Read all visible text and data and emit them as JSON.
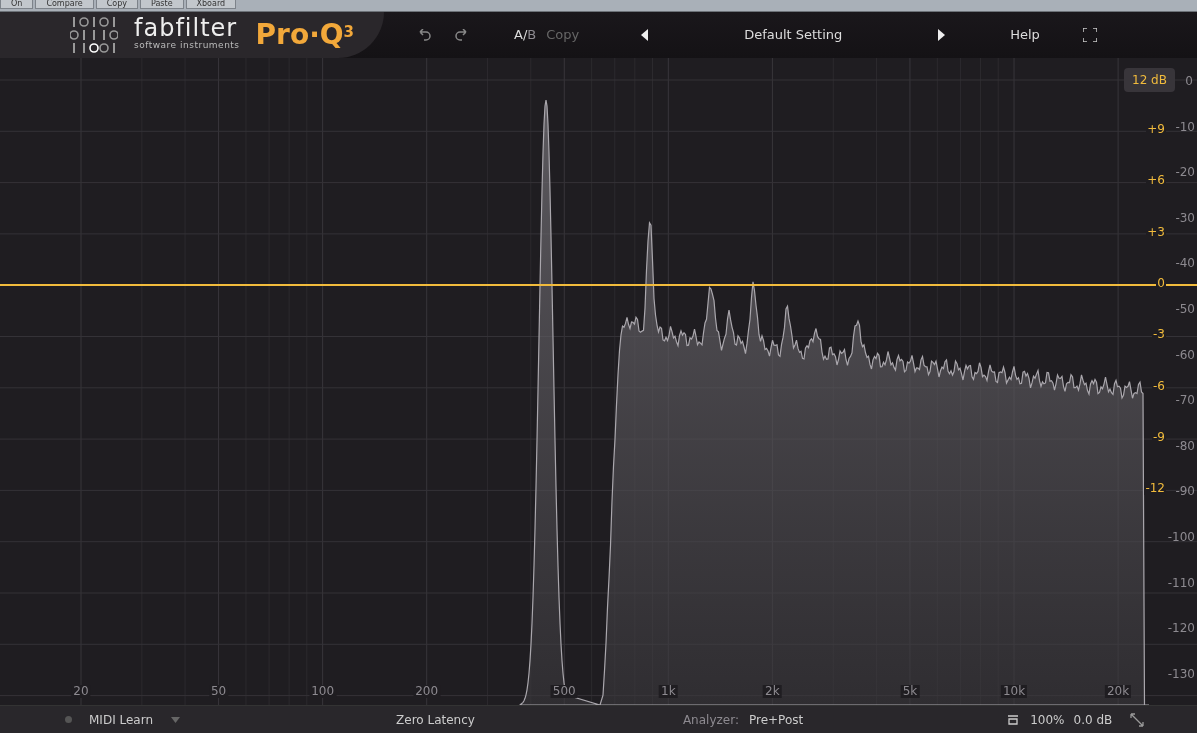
{
  "host_bar": {
    "buttons": [
      {
        "label": "On"
      },
      {
        "label": "Compare"
      },
      {
        "label": "Copy"
      },
      {
        "label": "Paste"
      },
      {
        "label": "Xboard"
      }
    ]
  },
  "header": {
    "brand": "fabfilter",
    "tagline": "software instruments",
    "product": "Pro·Q$^{3}$",
    "ab": "A/",
    "ab_b": "B",
    "copy": {
      "label": "Copy",
      "disabled": true
    },
    "preset": "Default Setting",
    "help": "Help"
  },
  "range_button": "12 dB",
  "eq_scale": [
    "+9",
    "+6",
    "+3",
    "0",
    "-3",
    "-6",
    "-9",
    "-12"
  ],
  "analyzer_scale": [
    "0",
    "-10",
    "-20",
    "-30",
    "-40",
    "-50",
    "-60",
    "-70",
    "-80",
    "-90",
    "-100",
    "-110",
    "-120",
    "-130"
  ],
  "freq_labels": [
    "20",
    "50",
    "100",
    "200",
    "500",
    "1k",
    "2k",
    "5k",
    "10k",
    "20k"
  ],
  "status_bar": {
    "midi": "MIDI Learn",
    "latency": "Zero Latency",
    "analyzer_label": "Analyzer:",
    "analyzer_value": "Pre+Post",
    "zoom": "100%",
    "gain": "0.0 dB"
  }
}
